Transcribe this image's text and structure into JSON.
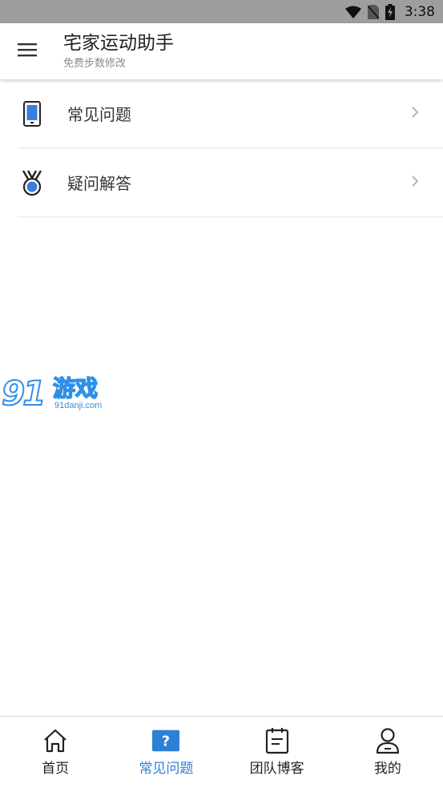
{
  "status_bar": {
    "time": "3:38",
    "icons": [
      "wifi-icon",
      "no-sim-icon",
      "battery-charging-icon"
    ]
  },
  "app_bar": {
    "menu_icon": "hamburger-menu-icon",
    "title": "宅家运动助手",
    "subtitle": "免费步数修改"
  },
  "list": {
    "items": [
      {
        "label": "常见问题",
        "icon": "phone-icon"
      },
      {
        "label": "疑问解答",
        "icon": "medal-icon"
      }
    ]
  },
  "watermark": {
    "number": "91",
    "text": "游戏",
    "url": "91danji.com"
  },
  "bottom_nav": {
    "items": [
      {
        "label": "首页",
        "icon": "home-icon",
        "active": false
      },
      {
        "label": "常见问题",
        "icon": "question-icon",
        "active": true
      },
      {
        "label": "团队博客",
        "icon": "notepad-icon",
        "active": false
      },
      {
        "label": "我的",
        "icon": "user-icon",
        "active": false
      }
    ]
  },
  "colors": {
    "accent": "#2e7fd6",
    "status_bar_bg": "#9e9e9e"
  }
}
